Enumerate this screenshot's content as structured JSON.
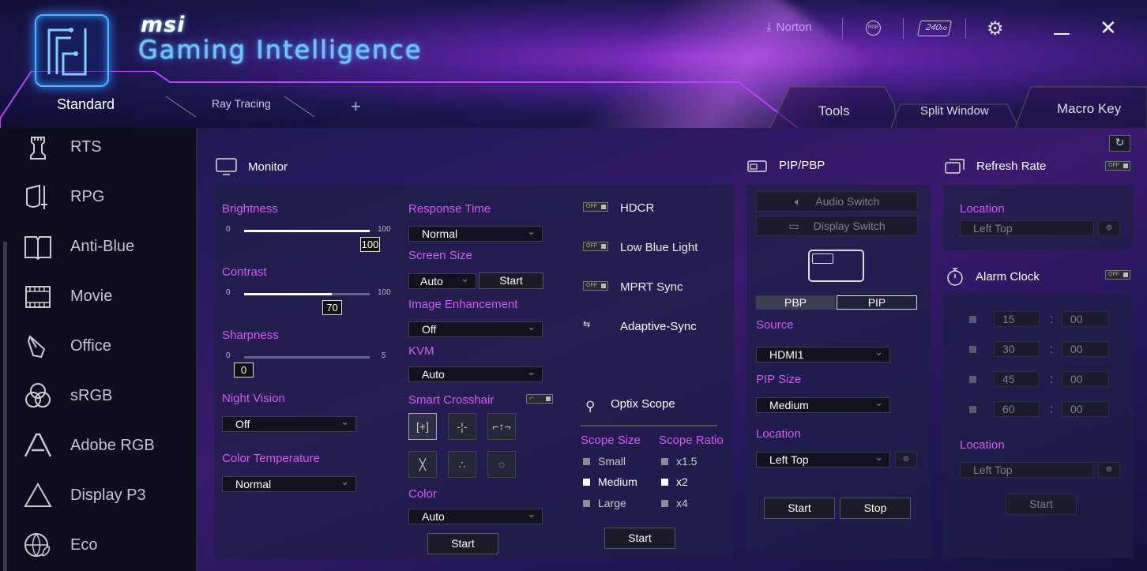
{
  "app": {
    "brand": "msi",
    "title": "Gaming Intelligence"
  },
  "topbar": {
    "norton": "Norton",
    "rgb": "RGB",
    "hz": "240",
    "hz_unit": "Hz"
  },
  "tabs": {
    "standard": "Standard",
    "ray": "Ray Tracing",
    "add": "+",
    "tools": "Tools",
    "split": "Split Window",
    "macro": "Macro Key"
  },
  "sidebar": {
    "items": [
      "RTS",
      "RPG",
      "Anti-Blue",
      "Movie",
      "Office",
      "sRGB",
      "Adobe RGB",
      "Display P3",
      "Eco"
    ]
  },
  "monitor": {
    "title": "Monitor",
    "brightness": {
      "label": "Brightness",
      "min": "0",
      "max": "100",
      "value": "100",
      "fraction": 1.0
    },
    "contrast": {
      "label": "Contrast",
      "min": "0",
      "max": "100",
      "value": "70",
      "fraction": 0.7
    },
    "sharpness": {
      "label": "Sharpness",
      "min": "0",
      "max": "5",
      "value": "0",
      "fraction": 0.0
    },
    "night_vision": {
      "label": "Night Vision",
      "value": "Off"
    },
    "color_temp": {
      "label": "Color Temperature",
      "value": "Normal"
    },
    "response_time": {
      "label": "Response Time",
      "value": "Normal"
    },
    "screen_size": {
      "label": "Screen Size",
      "value": "Auto",
      "start": "Start"
    },
    "image_enh": {
      "label": "Image Enhancement",
      "value": "Off"
    },
    "kvm": {
      "label": "KVM",
      "value": "Auto"
    },
    "crosshair": {
      "label": "Smart Crosshair"
    },
    "color": {
      "label": "Color",
      "value": "Auto",
      "start": "Start"
    },
    "toggles": {
      "hdcr": "HDCR",
      "lbl": "Low Blue Light",
      "mprt": "MPRT Sync",
      "adaptive": "Adaptive-Sync",
      "off": "OFF"
    },
    "optix": {
      "title": "Optix Scope",
      "size_label": "Scope Size",
      "ratio_label": "Scope Ratio",
      "sizes": [
        "Small",
        "Medium",
        "Large"
      ],
      "ratios": [
        "x1.5",
        "x2",
        "x4"
      ],
      "selected_size": "Medium",
      "selected_ratio": "x2",
      "start": "Start"
    }
  },
  "pip": {
    "title": "PIP/PBP",
    "audio": "Audio Switch",
    "display": "Display Switch",
    "pbp": "PBP",
    "pip": "PIP",
    "source_label": "Source",
    "source": "HDMI1",
    "size_label": "PIP Size",
    "size": "Medium",
    "loc_label": "Location",
    "loc": "Left Top",
    "start": "Start",
    "stop": "Stop"
  },
  "refresh": {
    "title": "Refresh Rate",
    "loc_label": "Location",
    "loc": "Left Top"
  },
  "alarm": {
    "title": "Alarm Clock",
    "rows": [
      [
        "15",
        "00"
      ],
      [
        "30",
        "00"
      ],
      [
        "45",
        "00"
      ],
      [
        "60",
        "00"
      ]
    ],
    "loc_label": "Location",
    "loc": "Left Top",
    "start": "Start"
  }
}
